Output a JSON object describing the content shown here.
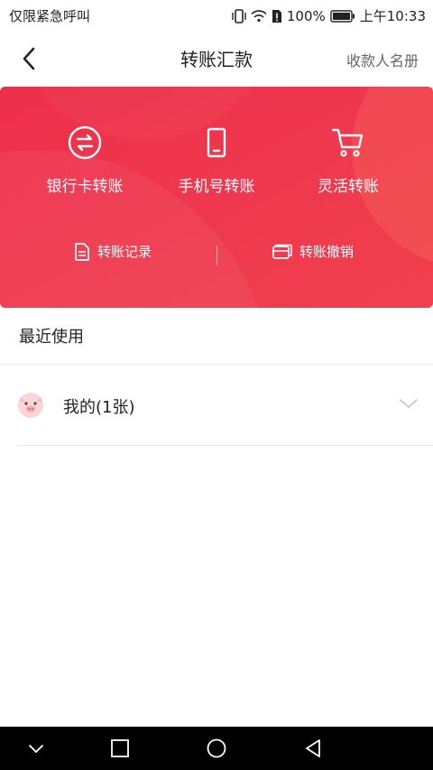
{
  "status_bar": {
    "carrier": "仅限紧急呼叫",
    "battery": "100%",
    "time": "上午10:33"
  },
  "header": {
    "title": "转账汇款",
    "right_link": "收款人名册"
  },
  "card": {
    "accent": "#ef3450",
    "features": [
      {
        "label": "银行卡转账",
        "icon": "transfer-arrows-icon"
      },
      {
        "label": "手机号转账",
        "icon": "phone-icon"
      },
      {
        "label": "灵活转账",
        "icon": "cart-icon"
      }
    ],
    "links": [
      {
        "label": "转账记录",
        "icon": "document-icon"
      },
      {
        "label": "转账撤销",
        "icon": "card-icon"
      }
    ]
  },
  "recent": {
    "title": "最近使用",
    "group": {
      "label": "我的(1张)",
      "icon": "pig-avatar-icon"
    }
  },
  "system_nav": {
    "icons": [
      "hide-keyboard-icon",
      "recent-apps-icon",
      "home-icon",
      "back-icon"
    ]
  }
}
